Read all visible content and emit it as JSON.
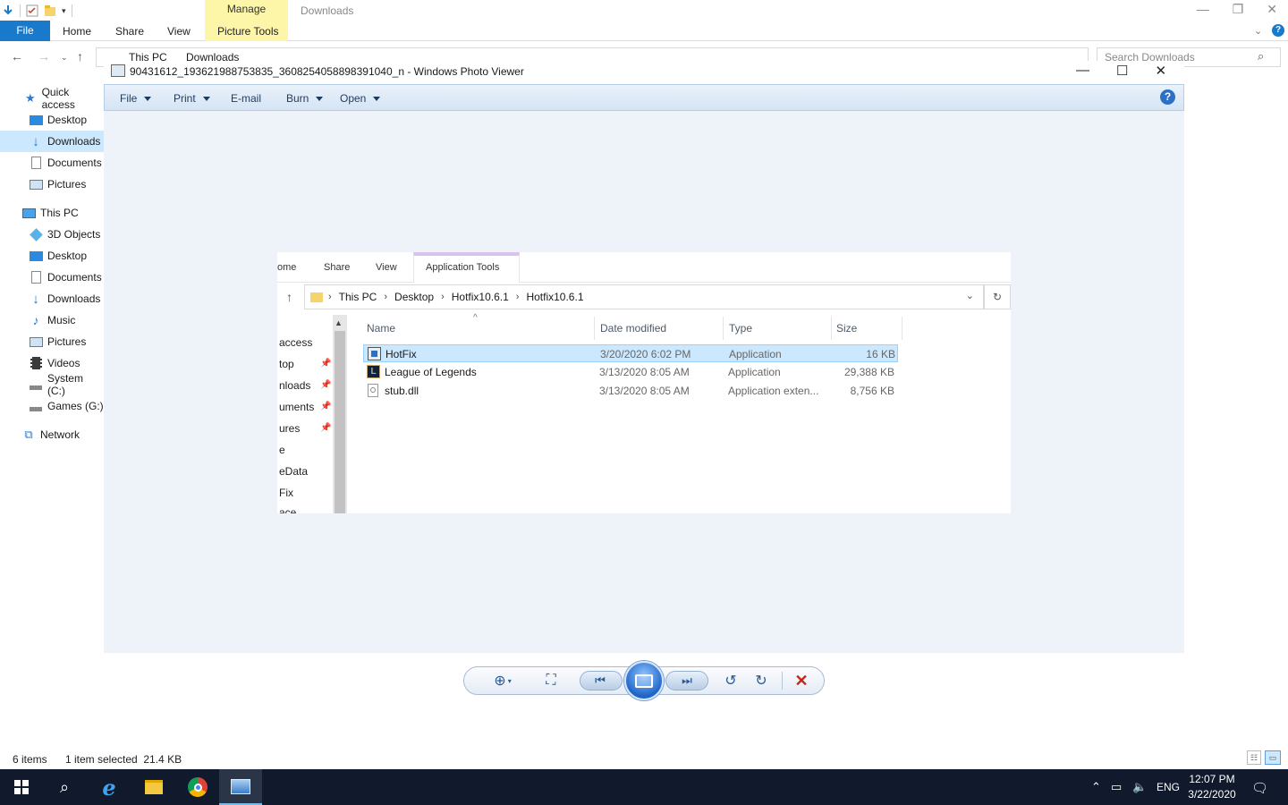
{
  "explorer": {
    "manage_tab": "Manage",
    "picture_tools_tab": "Picture Tools",
    "window_title": "Downloads",
    "file_tab": "File",
    "ribbon_tabs": [
      "Home",
      "Share",
      "View"
    ],
    "address_crumbs": [
      "This PC",
      "Downloads"
    ],
    "search_placeholder": "Search Downloads",
    "nav": {
      "quick_access": "Quick access",
      "desktop": "Desktop",
      "downloads": "Downloads",
      "documents": "Documents",
      "pictures": "Pictures",
      "this_pc": "This PC",
      "objects_3d": "3D Objects",
      "pc_desktop": "Desktop",
      "pc_documents": "Documents",
      "pc_downloads": "Downloads",
      "music": "Music",
      "pc_pictures": "Pictures",
      "videos": "Videos",
      "system_c": "System (C:)",
      "games_g": "Games (G:)",
      "network": "Network"
    },
    "status": {
      "items": "6 items",
      "selection": "1 item selected  21.4 KB"
    }
  },
  "photo_viewer": {
    "title": "90431612_193621988753835_3608254058898391040_n - Windows Photo Viewer",
    "menu": [
      "File",
      "Print",
      "E-mail",
      "Burn",
      "Open"
    ],
    "help_glyph": "?"
  },
  "image": {
    "tabs": [
      "ome",
      "Share",
      "View",
      "Application Tools"
    ],
    "crumbs": [
      "This PC",
      "Desktop",
      "Hotfix10.6.1",
      "Hotfix10.6.1"
    ],
    "nav_items": [
      "access",
      "top",
      "nloads",
      "uments",
      "ures",
      "e",
      "eData",
      "Fix",
      "ace"
    ],
    "columns": {
      "name": "Name",
      "date": "Date modified",
      "type": "Type",
      "size": "Size"
    },
    "files": [
      {
        "name": "HotFix",
        "date": "3/20/2020 6:02 PM",
        "type": "Application",
        "size": "16 KB"
      },
      {
        "name": "League of Legends",
        "date": "3/13/2020 8:05 AM",
        "type": "Application",
        "size": "29,388 KB"
      },
      {
        "name": "stub.dll",
        "date": "3/13/2020 8:05 AM",
        "type": "Application exten...",
        "size": "8,756 KB"
      }
    ]
  },
  "taskbar": {
    "language": "ENG",
    "time": "12:07 PM",
    "date": "3/22/2020"
  },
  "colors": {
    "accent": "#1979ca",
    "manage": "#fdf6a8",
    "selection": "#cce8ff",
    "taskbar": "#101a2c"
  }
}
